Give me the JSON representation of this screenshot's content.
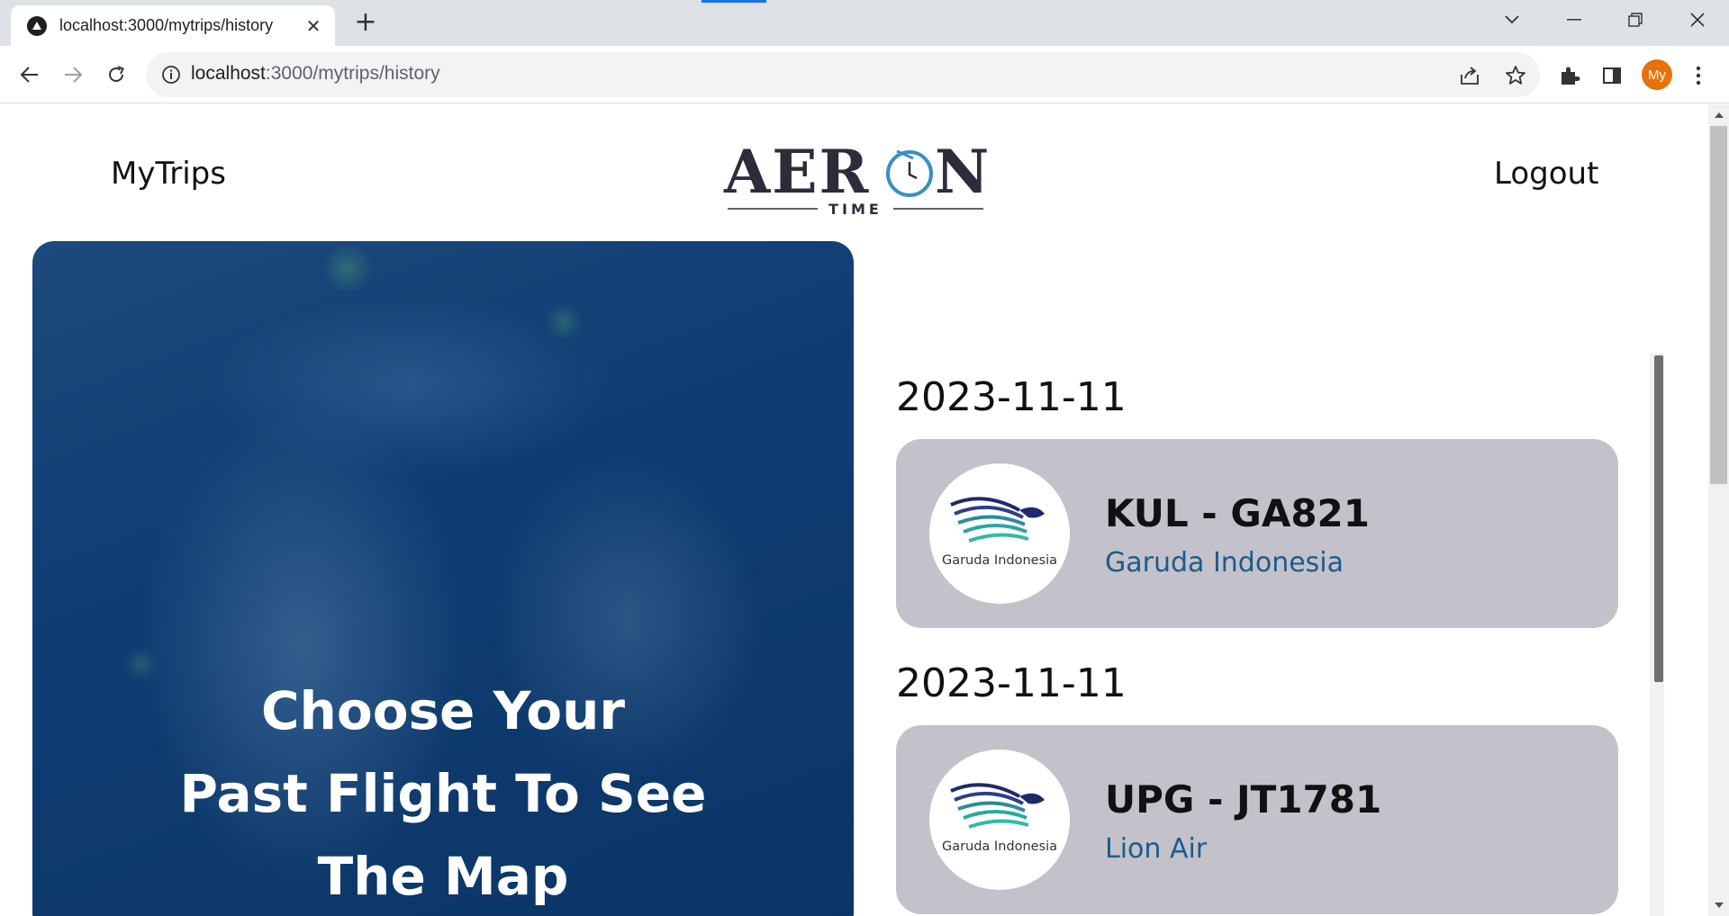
{
  "browser": {
    "tab_title": "localhost:3000/mytrips/history",
    "url_host": "localhost",
    "url_path": ":3000/mytrips/history",
    "profile_initials": "My",
    "profile_color": "#e8710a"
  },
  "nav": {
    "left_link": "MyTrips",
    "right_link": "Logout"
  },
  "logo": {
    "word": "AERON",
    "sub": "TIME"
  },
  "hero": {
    "line1": "Choose Your",
    "line2": "Past Flight To See",
    "line3": "The Map"
  },
  "trips": [
    {
      "date": "2023-11-11",
      "title": "KUL - GA821",
      "airline": "Garuda Indonesia",
      "logo_text": "Garuda Indonesia"
    },
    {
      "date": "2023-11-11",
      "title": "UPG - JT1781",
      "airline": "Lion Air",
      "logo_text": "Garuda Indonesia"
    }
  ],
  "colors": {
    "card_bg": "#c3c2ca",
    "airline_text": "#1e5a8a",
    "hero_bg": "#0f3d72"
  }
}
